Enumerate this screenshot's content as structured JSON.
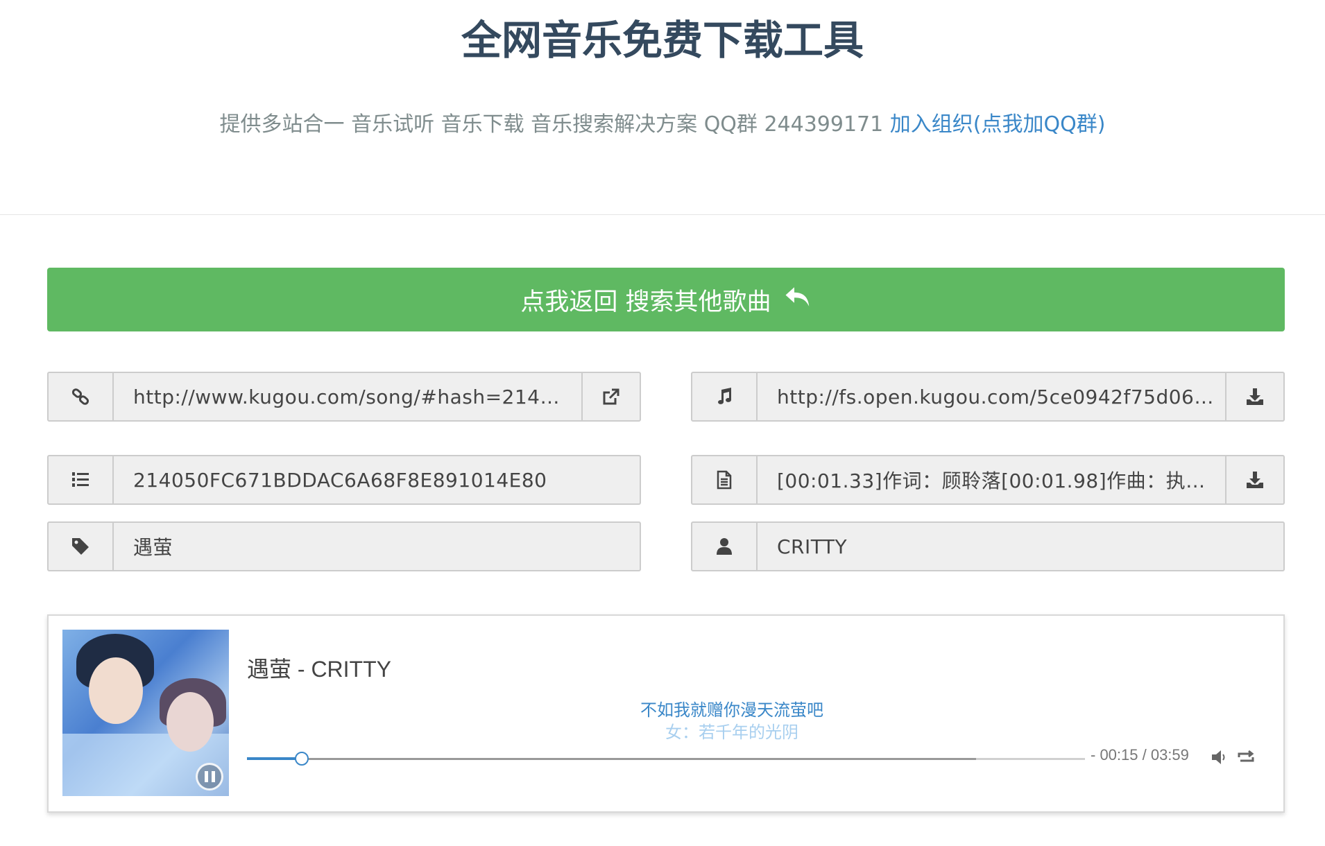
{
  "header": {
    "title": "全网音乐免费下载工具",
    "subtitle": "提供多站合一 音乐试听 音乐下载 音乐搜索解决方案 QQ群 244399171",
    "join_link": "加入组织(点我加QQ群)"
  },
  "back_button": {
    "label": "点我返回 搜索其他歌曲",
    "color": "#5fb962"
  },
  "fields": {
    "song_link": "http://www.kugou.com/song/#hash=214…",
    "audio_url": "http://fs.open.kugou.com/5ce0942f75d06…",
    "song_id": "214050FC671BDDAC6A68F8E891014E80",
    "lyrics": "[00:01.33]作词：顾聆落[00:01.98]作曲：执…",
    "song_name": "遇萤",
    "artist": "CRITTY"
  },
  "player": {
    "title": "遇萤 - CRITTY",
    "lyric_current": "不如我就赠你漫天流萤吧",
    "lyric_next": "女：若千年的光阴",
    "time_display": "- 00:15 / 03:59",
    "progress_played": 0.065,
    "progress_loaded": 0.87,
    "accent_color": "#3a87c8",
    "state": "playing"
  },
  "icons": {
    "song_link": "link-icon",
    "audio_url": "music-note-icon",
    "song_id": "list-ol-icon",
    "lyrics": "file-text-icon",
    "song_name": "tag-icon",
    "artist": "user-icon"
  }
}
